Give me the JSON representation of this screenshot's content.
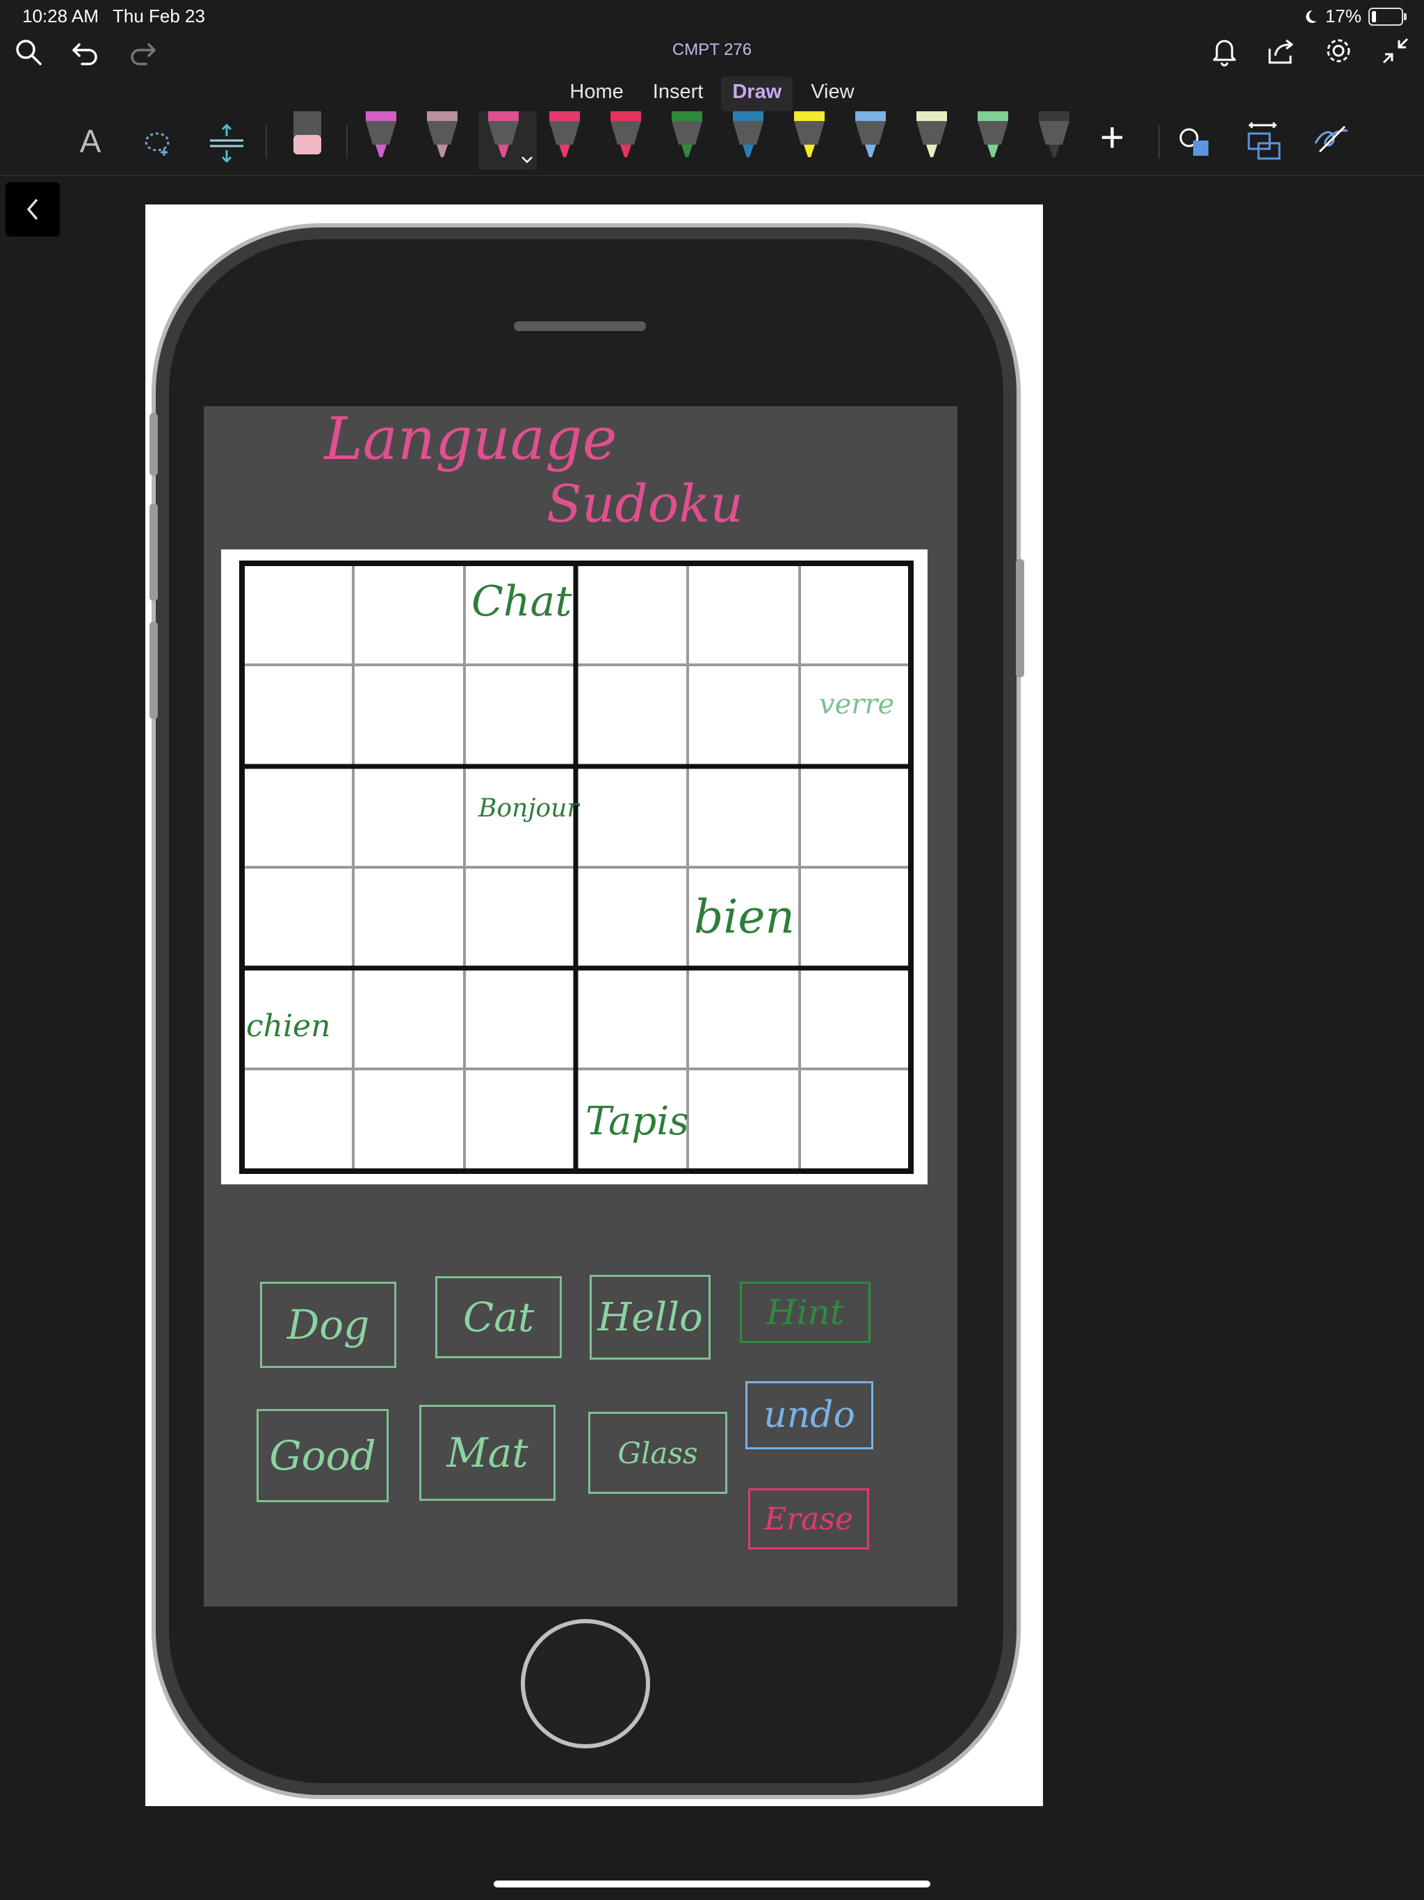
{
  "status_bar": {
    "time": "10:28 AM",
    "date": "Thu Feb 23",
    "battery": "17%",
    "battery_level": 0.17
  },
  "header": {
    "notebook_title": "CMPT 276"
  },
  "tabs": [
    {
      "label": "Home",
      "active": false
    },
    {
      "label": "Insert",
      "active": false
    },
    {
      "label": "Draw",
      "active": true
    },
    {
      "label": "View",
      "active": false
    }
  ],
  "toolbar": {
    "text_tool_label": "A",
    "pens": [
      {
        "color": "#d160c8"
      },
      {
        "color": "#b8909f"
      },
      {
        "color": "#e0508f"
      },
      {
        "color": "#e23a6b"
      },
      {
        "color": "#e6335d"
      },
      {
        "color": "#2e8b3e"
      },
      {
        "color": "#2b7fb0"
      },
      {
        "color": "#f2ea2c"
      },
      {
        "color": "#7ab2e6"
      },
      {
        "color": "#e8ecc2"
      },
      {
        "color": "#7fcf95"
      },
      {
        "color": "#3a3a3a"
      }
    ],
    "add_label": "+"
  },
  "canvas": {
    "heading_line1": "Language",
    "heading_line2": "Sudoku",
    "cells": [
      {
        "row": 0,
        "col": 2,
        "text": "Chat"
      },
      {
        "row": 1,
        "col": 5,
        "text": "verre"
      },
      {
        "row": 2,
        "col": 2,
        "text": "Bonjour"
      },
      {
        "row": 3,
        "col": 4,
        "text": "bien"
      },
      {
        "row": 4,
        "col": 0,
        "text": "chien"
      },
      {
        "row": 5,
        "col": 3,
        "text": "Tapis"
      }
    ],
    "word_buttons": {
      "dog": "Dog",
      "cat": "Cat",
      "hello": "Hello",
      "good": "Good",
      "mat": "Mat",
      "glass": "Glass"
    },
    "action_buttons": {
      "hint": "Hint",
      "undo": "undo",
      "erase": "Erase"
    }
  },
  "colors": {
    "ink_pink": "#e0508f",
    "ink_green": "#2e7d3a",
    "ink_light_green": "#7fbf94",
    "hint_green": "#2e8b3e",
    "undo_blue": "#7ab2e6",
    "erase_red": "#e23a6b",
    "tab_active": "#c9a8f4"
  }
}
